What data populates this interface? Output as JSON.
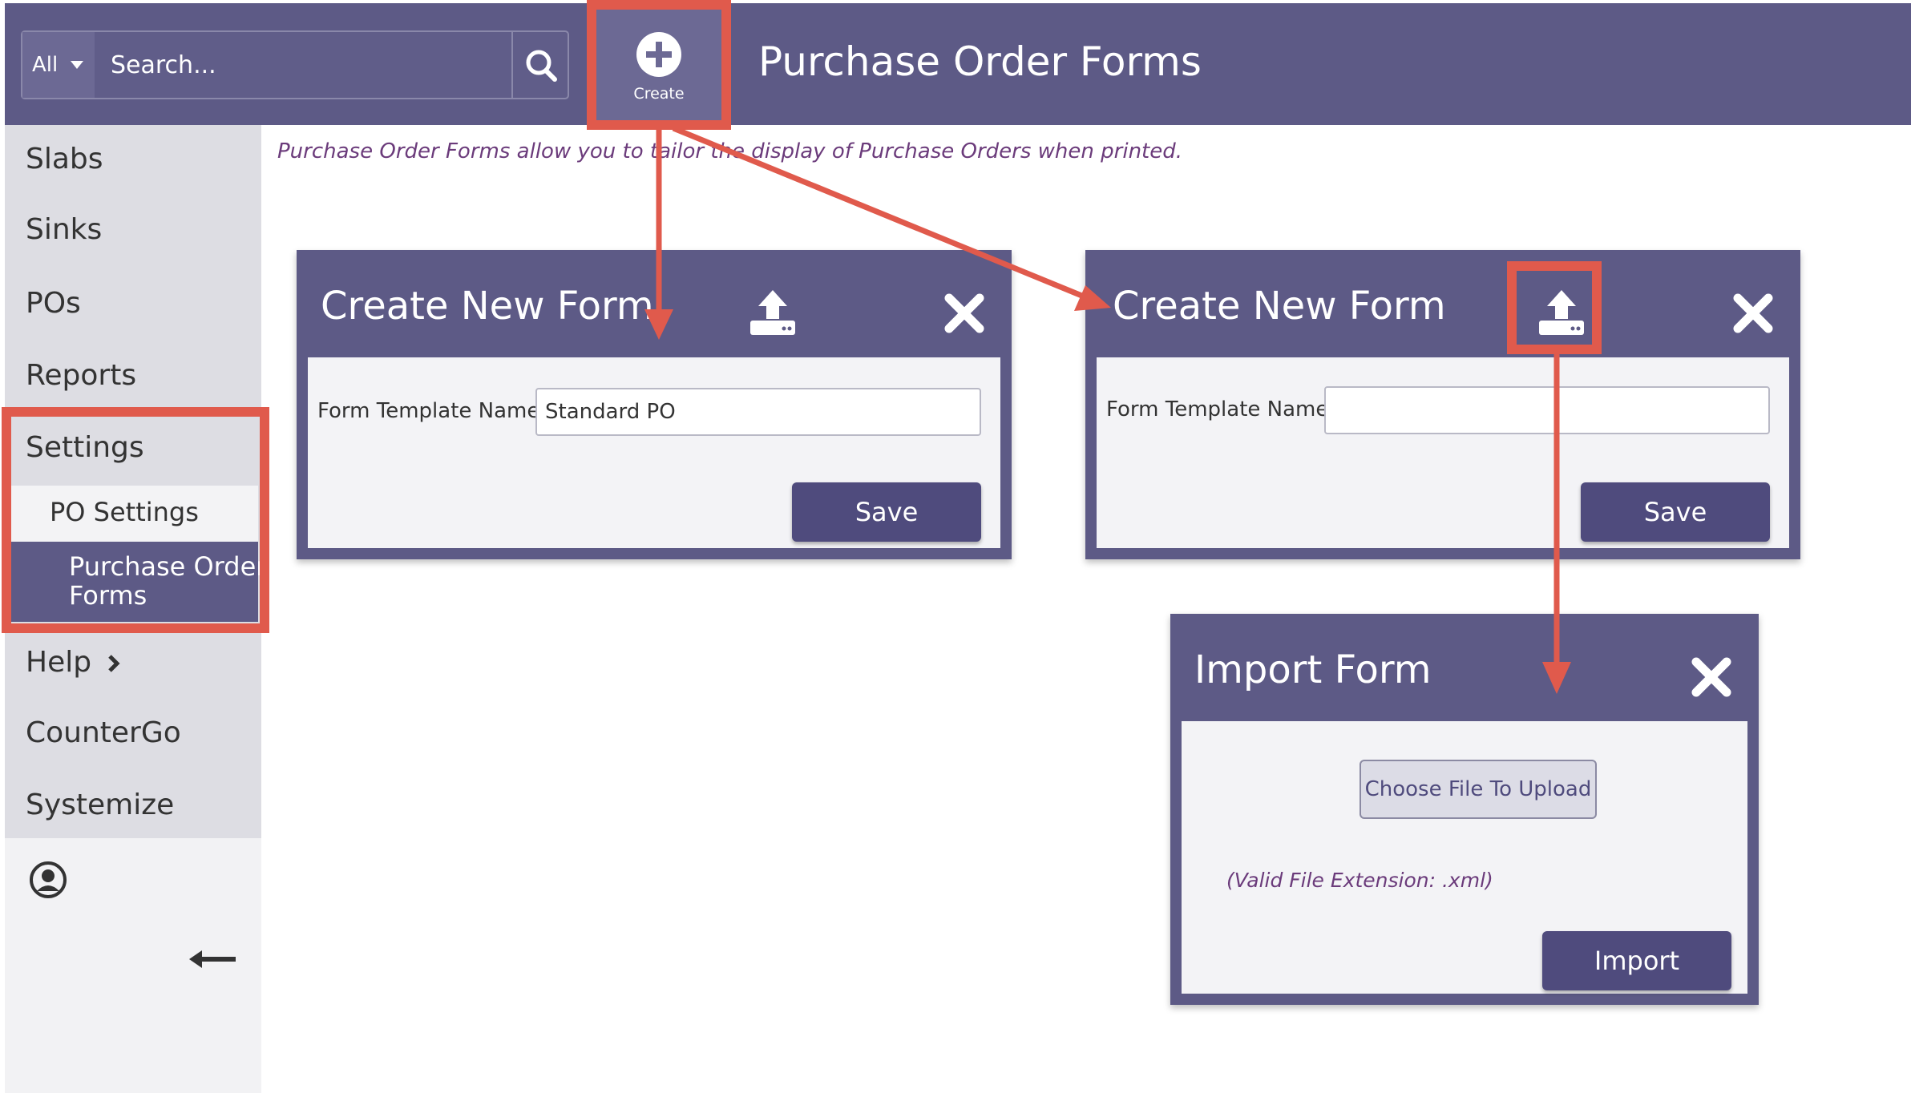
{
  "header": {
    "search_scope": "All",
    "search_placeholder": "Search...",
    "create_label": "Create",
    "title": "Purchase Order Forms"
  },
  "sidebar": {
    "items": [
      "Slabs",
      "Sinks",
      "POs",
      "Reports",
      "Settings"
    ],
    "sub_items": [
      "PO Settings",
      "Purchase Order Forms"
    ],
    "sub_item_lines": [
      "Purchase Order",
      "Forms"
    ],
    "lower_items": [
      "Help",
      "CounterGo",
      "Systemize"
    ]
  },
  "intro_text": "Purchase Order Forms allow you to tailor the display of Purchase Orders when printed.",
  "dialog_create_filled": {
    "title": "Create New Form",
    "field_label": "Form Template Name:",
    "field_value": "Standard PO",
    "save_label": "Save"
  },
  "dialog_create_empty": {
    "title": "Create New Form",
    "field_label": "Form Template Name:",
    "field_value": "",
    "save_label": "Save"
  },
  "dialog_import": {
    "title": "Import Form",
    "choose_file_label": "Choose File To Upload",
    "hint": "(Valid File Extension: .xml)",
    "import_label": "Import"
  },
  "colors": {
    "header_bg": "#5d5a86",
    "highlight": "#e05a4c",
    "button_bg": "#4f4b7d",
    "intro_text": "#6b3b7b"
  },
  "icons": [
    "search-icon",
    "plus-circle-icon",
    "upload-icon",
    "close-icon",
    "chevron-right-icon",
    "user-circle-icon",
    "arrow-left-icon"
  ]
}
